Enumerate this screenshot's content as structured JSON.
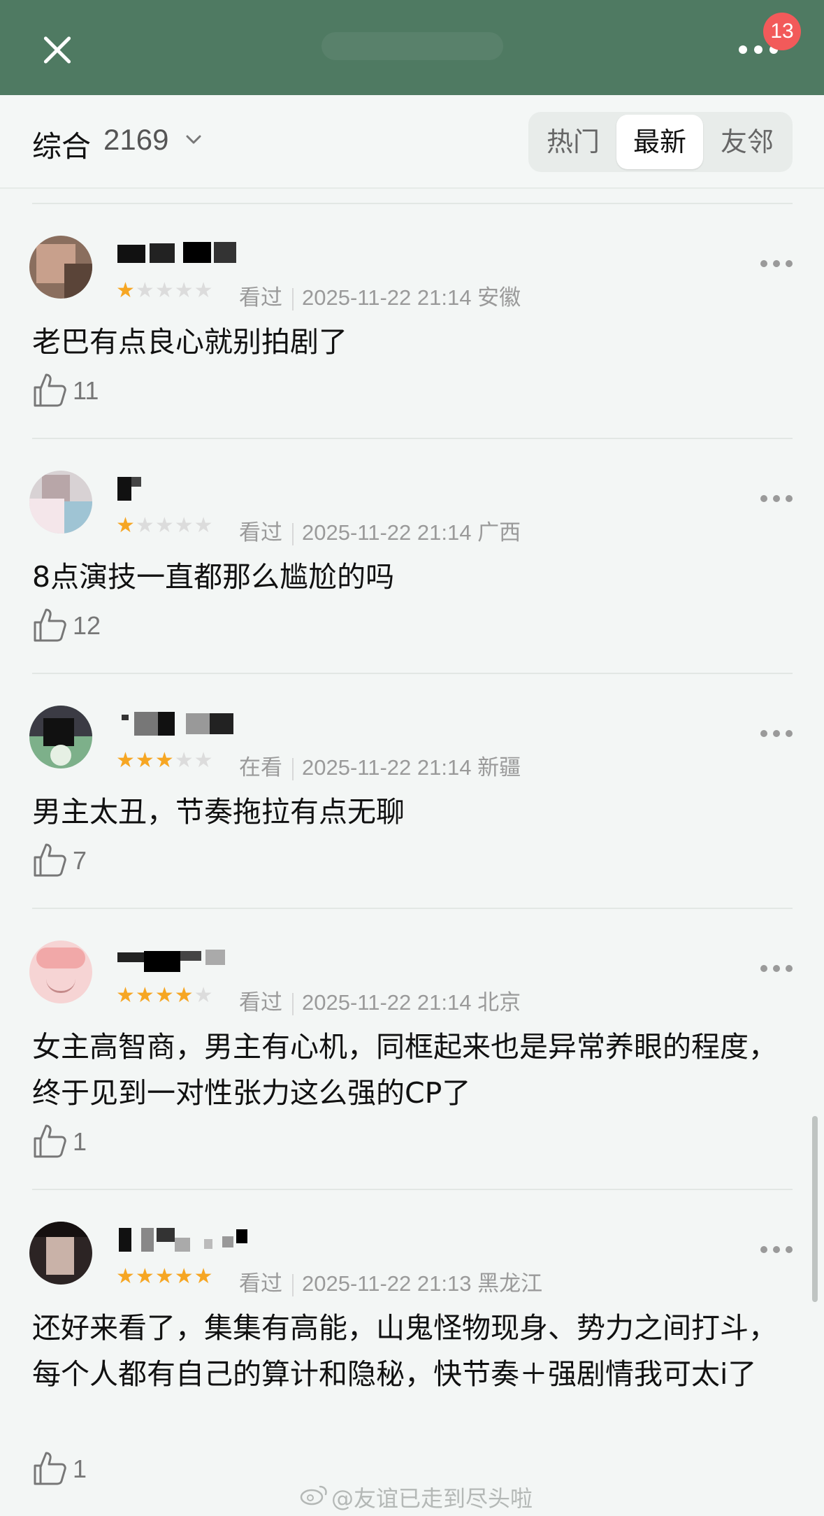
{
  "topbar": {
    "notification_count": "13"
  },
  "filter": {
    "sort_label": "综合",
    "count": "2169",
    "tabs": [
      {
        "label": "热门",
        "active": false
      },
      {
        "label": "最新",
        "active": true
      },
      {
        "label": "友邻",
        "active": false
      }
    ]
  },
  "reviews": [
    {
      "rating": 1,
      "status": "看过",
      "time": "2025-11-22 21:14",
      "location": "安徽",
      "content": "老巴有点良心就别拍剧了",
      "likes": "11"
    },
    {
      "rating": 1,
      "status": "看过",
      "time": "2025-11-22 21:14",
      "location": "广西",
      "content": "8点演技一直都那么尴尬的吗",
      "likes": "12"
    },
    {
      "rating": 3,
      "status": "在看",
      "time": "2025-11-22 21:14",
      "location": "新疆",
      "content": "男主太丑，节奏拖拉有点无聊",
      "likes": "7"
    },
    {
      "rating": 4,
      "status": "看过",
      "time": "2025-11-22 21:14",
      "location": "北京",
      "content": "女主高智商，男主有心机，同框起来也是异常养眼的程度，终于见到一对性张力这么强的CP了",
      "likes": "1"
    },
    {
      "rating": 5,
      "status": "看过",
      "time": "2025-11-22 21:13",
      "location": "黑龙江",
      "content": "还好来看了，集集有高能，山鬼怪物现身、势力之间打斗，每个人都有自己的算计和隐秘，快节奏＋强剧情我可太i了",
      "likes": "1"
    }
  ],
  "watermark": "@友谊已走到尽头啦",
  "colors": {
    "header": "#4f7a62",
    "star": "#f6a623",
    "badge": "#f25a5a"
  }
}
